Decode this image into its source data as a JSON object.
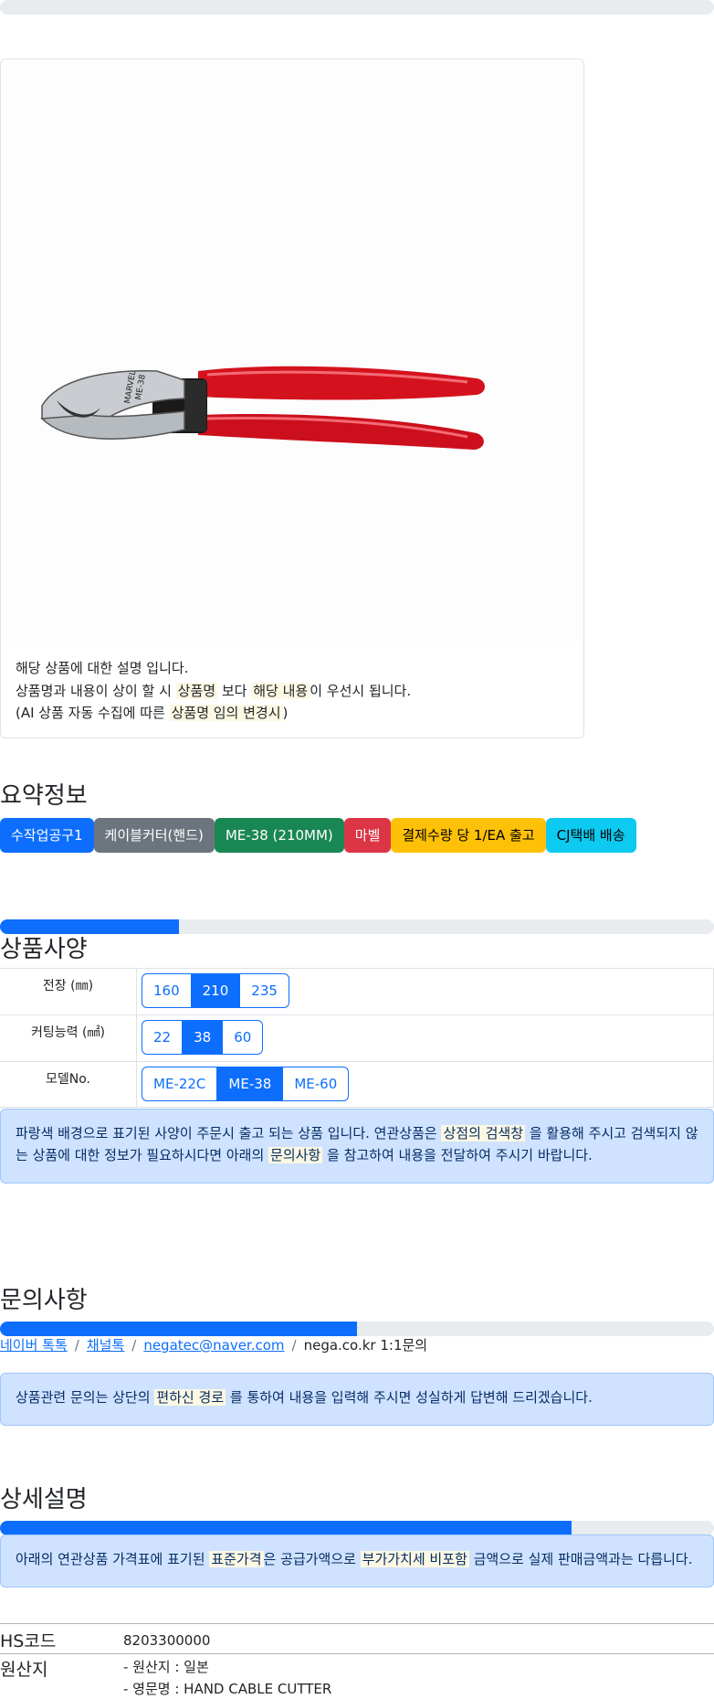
{
  "progress_top": {
    "fill_fraction": 0
  },
  "product_card": {
    "image_alt": "MARVEL ME-38 cable cutter",
    "image_text": [
      "MARVEL",
      "ME-38"
    ],
    "desc_line1": "해당 상품에 대한 설명 입니다.",
    "desc_line2_a": "상품명과 내용이 상이 할 시",
    "desc_line2_mark1": "상품명",
    "desc_line2_b": "보다",
    "desc_line2_mark2": "해당 내용",
    "desc_line2_c": "이 우선시 됩니다.",
    "desc_line3_a": "(AI 상품 자동 수집에 따른",
    "desc_line3_mark": "상품명 임의 변경시",
    "desc_line3_b": ")"
  },
  "summary": {
    "title": "요약정보",
    "badges": [
      {
        "label": "수작업공구1",
        "color": "#0d6efd"
      },
      {
        "label": "케이블커터(핸드)",
        "color": "#6c757d"
      },
      {
        "label": "ME-38 (210MM)",
        "color": "#198754"
      },
      {
        "label": "마벨",
        "color": "#dc3545"
      },
      {
        "label": "결제수량 당 1/EA 출고",
        "color": "#ffc107"
      },
      {
        "label": "CJ택배 배송",
        "color": "#0dcaf0"
      }
    ]
  },
  "spec": {
    "progress_fill_fraction": 0.25,
    "title": "상품사양",
    "rows": [
      {
        "label": "전장 (㎜)",
        "options": [
          "160",
          "210",
          "235"
        ],
        "active": 1
      },
      {
        "label": "커팅능력 (㎟)",
        "options": [
          "22",
          "38",
          "60"
        ],
        "active": 1
      },
      {
        "label": "모델No.",
        "options": [
          "ME-22C",
          "ME-38",
          "ME-60"
        ],
        "active": 1
      }
    ],
    "alert_a": "파랑색 배경으로 표기된 사양이 주문시 출고 되는 상품 입니다. 연관상품은",
    "alert_mark1": "상점의 검색창",
    "alert_b": "을 활용해 주시고 검색되지 않는 상품에 대한 정보가 필요하시다면 아래의",
    "alert_mark2": "문의사항",
    "alert_c": "을 참고하여 내용을 전달하여 주시기 바랍니다."
  },
  "inquiry": {
    "title": "문의사항",
    "progress_fill_fraction": 0.5,
    "links": [
      "네이버 톡톡",
      "채널톡",
      "negatec@naver.com"
    ],
    "plain": "nega.co.kr 1:1문의",
    "separator": "/",
    "alert_a": "상품관련 문의는 상단의",
    "alert_mark": "편하신 경로",
    "alert_b": "를 통하여 내용을 입력해 주시면 성실하게 답변해 드리겠습니다."
  },
  "detail": {
    "title": "상세설명",
    "progress_fill_fraction": 0.8,
    "alert_a": "아래의 연관상품 가격표에 표기된",
    "alert_mark1": "표준가격",
    "alert_b": "은 공급가액으로",
    "alert_mark2": "부가가치세 비포함",
    "alert_c": "금액으로 실제 판매금액과는 다릅니다.",
    "hs_key": "HS코드",
    "hs_value": "8203300000",
    "origin_key": "원산지",
    "origin_line1": "- 원산지 : 일본",
    "origin_line2": "- 영문명 : HAND CABLE CUTTER"
  }
}
